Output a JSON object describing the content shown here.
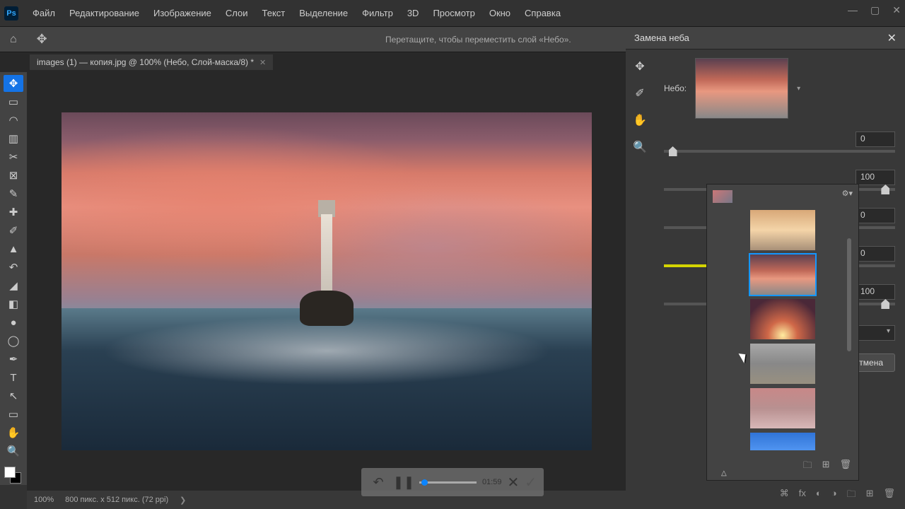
{
  "app": {
    "logo": "Ps"
  },
  "menu": [
    "Файл",
    "Редактирование",
    "Изображение",
    "Слои",
    "Текст",
    "Выделение",
    "Фильтр",
    "3D",
    "Просмотр",
    "Окно",
    "Справка"
  ],
  "option_hint": "Перетащите, чтобы переместить слой «Небо».",
  "doc_tab": "images (1) — копия.jpg @ 100% (Небо, Слой-маска/8) *",
  "status": {
    "zoom": "100%",
    "dims": "800 пикс. x 512 пикс. (72 ppi)"
  },
  "playback": {
    "time": "01:59"
  },
  "sky_panel": {
    "title": "Замена неба",
    "sky_label": "Небо:",
    "sliders": [
      {
        "val": "0",
        "pos": 2
      },
      {
        "val": "100",
        "pos": 96
      },
      {
        "val": "0",
        "pos": 48
      },
      {
        "val": "0",
        "pos": 48,
        "yellow": true
      },
      {
        "val": "100",
        "pos": 96
      }
    ],
    "cancel": "Отмена"
  }
}
